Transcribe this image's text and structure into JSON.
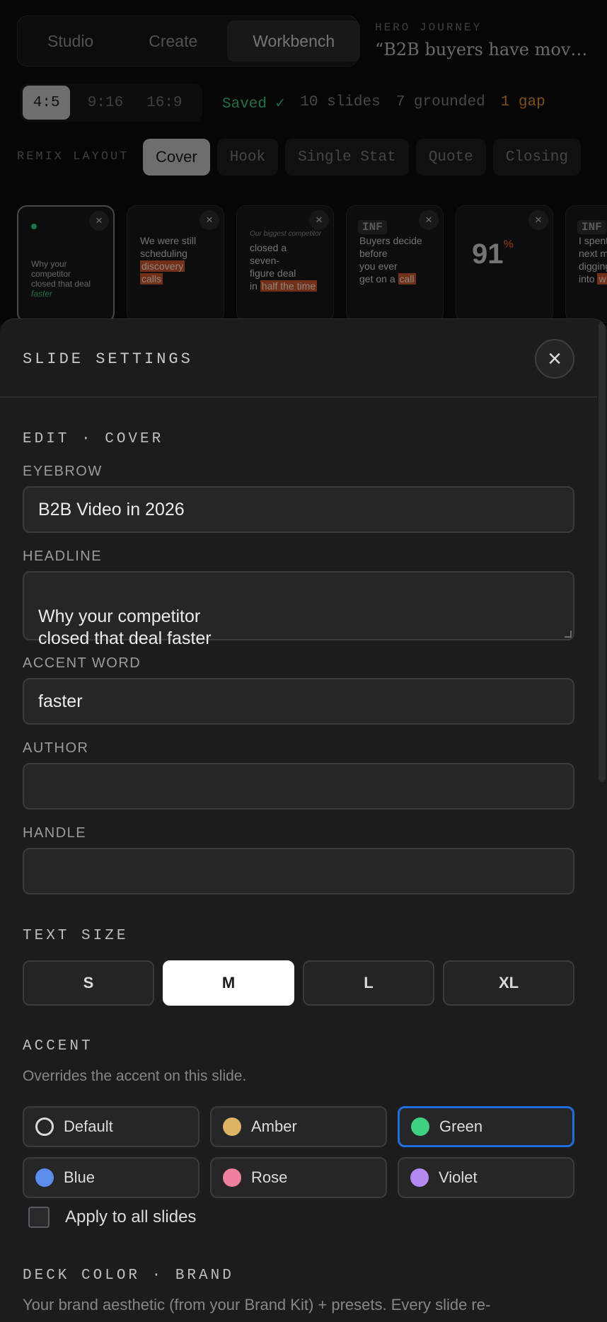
{
  "mode_tabs": [
    {
      "label": "Studio",
      "active": false
    },
    {
      "label": "Create",
      "active": false
    },
    {
      "label": "Workbench",
      "active": true
    }
  ],
  "hero": {
    "label": "HERO JOURNEY",
    "quote": "“B2B buyers have mov…"
  },
  "ratios": [
    {
      "label": "4:5",
      "active": true
    },
    {
      "label": "9:16",
      "active": false
    },
    {
      "label": "16:9",
      "active": false
    }
  ],
  "status": {
    "saved": "Saved ✓",
    "slides": "10 slides",
    "grounded": "7 grounded",
    "gap": "1 gap"
  },
  "remix": {
    "label": "REMIX LAYOUT",
    "options": [
      {
        "label": "Cover",
        "active": true
      },
      {
        "label": "Hook",
        "active": false
      },
      {
        "label": "Single Stat",
        "active": false
      },
      {
        "label": "Quote",
        "active": false
      },
      {
        "label": "Closing",
        "active": false
      }
    ]
  },
  "thumbnails": {
    "close_glyph": "×",
    "slide1": {
      "lines": [
        "Why your",
        "competitor",
        "closed that deal"
      ],
      "accent": "faster"
    },
    "slide2": {
      "line1": "We were still",
      "line2": "scheduling",
      "hl1": "discovery",
      "hl2": "calls"
    },
    "slide3": {
      "eyebrow": "Our biggest competitor",
      "line1": "closed a",
      "line2": "seven-",
      "line3": "figure deal",
      "pre": "in",
      "hl": "half the time"
    },
    "slide4": {
      "tag": "INF",
      "line1": "Buyers decide",
      "line2": "before",
      "line3": "you ever",
      "pre": "get on a",
      "hl": "call"
    },
    "slide5": {
      "stat": "91",
      "unit": "%"
    },
    "slide6": {
      "tag": "INF",
      "line1": "I spent",
      "line2": "next m",
      "line3": "digging",
      "pre": "into",
      "hl": "w"
    }
  },
  "sheet": {
    "title": "SLIDE SETTINGS",
    "close_glyph": "×",
    "edit_title": "EDIT · COVER",
    "fields": {
      "eyebrow": {
        "label": "EYEBROW",
        "value": "B2B Video in 2026"
      },
      "headline": {
        "label": "HEADLINE",
        "value": "Why your competitor\nclosed that deal faster"
      },
      "accent_word": {
        "label": "ACCENT WORD",
        "value": "faster"
      },
      "author": {
        "label": "AUTHOR",
        "value": ""
      },
      "handle": {
        "label": "HANDLE",
        "value": ""
      }
    },
    "text_size": {
      "title": "TEXT SIZE",
      "options": [
        {
          "label": "S",
          "active": false
        },
        {
          "label": "M",
          "active": true
        },
        {
          "label": "L",
          "active": false
        },
        {
          "label": "XL",
          "active": false
        }
      ]
    },
    "accent": {
      "title": "ACCENT",
      "hint": "Overrides the accent on this slide.",
      "options": [
        {
          "label": "Default",
          "color": "",
          "active": false
        },
        {
          "label": "Amber",
          "color": "#dcb463",
          "active": false
        },
        {
          "label": "Green",
          "color": "#3ed27f",
          "active": true
        },
        {
          "label": "Blue",
          "color": "#5b8def",
          "active": false
        },
        {
          "label": "Rose",
          "color": "#f07fa0",
          "active": false
        },
        {
          "label": "Violet",
          "color": "#b48af2",
          "active": false
        }
      ]
    },
    "apply_all": {
      "label": "Apply to all slides",
      "checked": false
    },
    "deck_color": {
      "title": "DECK COLOR · BRAND",
      "hint": "Your brand aesthetic (from your Brand Kit) + presets. Every slide re-"
    }
  },
  "colors": {
    "accent_green": "#3dbf78",
    "gap_orange": "#d58a2c",
    "selection_blue": "#1f6fdb",
    "highlight_orange": "#c4542c"
  }
}
